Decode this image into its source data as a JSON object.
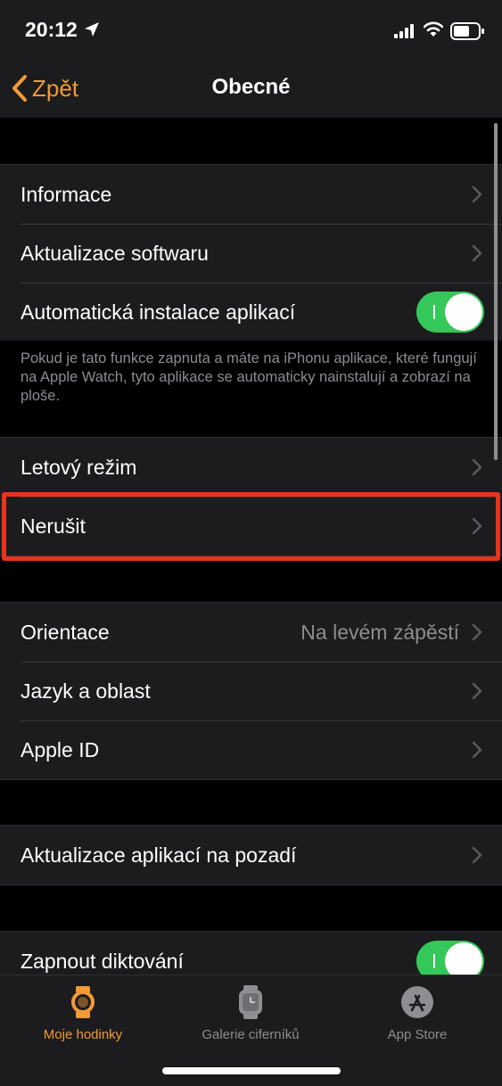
{
  "status": {
    "time": "20:12"
  },
  "nav": {
    "back_label": "Zpět",
    "title": "Obecné"
  },
  "sections": {
    "general": {
      "info": "Informace",
      "software_update": "Aktualizace softwaru",
      "auto_install": "Automatická instalace aplikací",
      "auto_install_on": true,
      "note": "Pokud je tato funkce zapnuta a máte na iPhonu aplikace, které fungují na Apple Watch, tyto aplikace se automaticky nainstalují a zobrazí na ploše."
    },
    "modes": {
      "airplane": "Letový režim",
      "dnd": "Nerušit"
    },
    "locale": {
      "orientation": "Orientace",
      "orientation_value": "Na levém zápěstí",
      "language": "Jazyk a oblast",
      "apple_id": "Apple ID"
    },
    "background": {
      "background_refresh": "Aktualizace aplikací na pozadí"
    },
    "dictation": {
      "label": "Zapnout diktování",
      "on": true
    }
  },
  "tabs": [
    {
      "label": "Moje hodinky",
      "icon": "watch-icon",
      "active": true
    },
    {
      "label": "Galerie ciferníků",
      "icon": "watch-face-icon",
      "active": false
    },
    {
      "label": "App Store",
      "icon": "app-store-icon",
      "active": false
    }
  ],
  "colors": {
    "accent": "#f19a37",
    "toggle_on": "#34c759",
    "highlight": "#e8331f"
  }
}
